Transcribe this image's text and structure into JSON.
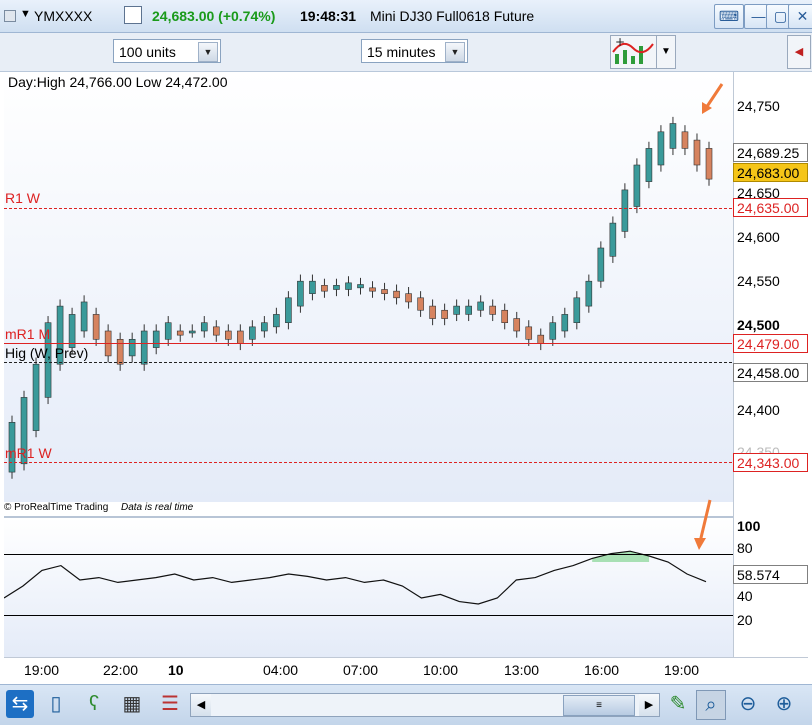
{
  "titlebar": {
    "symbol": "YMXXXX",
    "price_change": "24,683.00 (+0.74%)",
    "time": "19:48:31",
    "instrument": "Mini DJ30 Full0618 Future",
    "dropdown_icon": "caret-down-icon",
    "tile_icon": "tile-window-icon",
    "keyboard_icon": "keyboard-icon",
    "minimize_icon": "minimize-icon",
    "restore_icon": "restore-icon",
    "close_icon": "close-icon"
  },
  "toolbar": {
    "units_value": "100 units",
    "interval_value": "15 minutes"
  },
  "chart": {
    "day_info": "Day:High 24,766.00 Low 24,472.00",
    "credit": "© ProRealTime Trading",
    "realtime": "Data is real time",
    "level_labels": {
      "r1w": "R1 W",
      "mr1m": "mR1 M",
      "hig": "Hig (W, Prev)",
      "mr1w": "mR1 W"
    }
  },
  "price_axis": {
    "ticks": [
      "24,750",
      "24,650",
      "24,600",
      "24,550",
      "24,500",
      "24,458.00",
      "24,400",
      "24,350"
    ],
    "tags": {
      "current_high": "24,689.25",
      "last": "24,683.00",
      "r1w": "24,635.00",
      "mr1m": "24,479.00",
      "hig": "24,458.00",
      "mr1w": "24,343.00"
    }
  },
  "indicator_axis": {
    "ticks": [
      "100",
      "80",
      "40",
      "20"
    ],
    "value": "58.574"
  },
  "time_axis": {
    "labels": [
      "19:00",
      "22:00",
      "10",
      "04:00",
      "07:00",
      "10:00",
      "13:00",
      "16:00",
      "19:00"
    ]
  },
  "chart_data": {
    "type": "candlestick",
    "ylim": [
      24300,
      24800
    ],
    "candles": [
      [
        24330,
        24390
      ],
      [
        24340,
        24420
      ],
      [
        24380,
        24460
      ],
      [
        24420,
        24510
      ],
      [
        24460,
        24530
      ],
      [
        24480,
        24520
      ],
      [
        24500,
        24535
      ],
      [
        24490,
        24520
      ],
      [
        24470,
        24500
      ],
      [
        24460,
        24490
      ],
      [
        24470,
        24490
      ],
      [
        24460,
        24500
      ],
      [
        24480,
        24500
      ],
      [
        24490,
        24510
      ],
      [
        24495,
        24500
      ],
      [
        24500,
        24500
      ],
      [
        24500,
        24510
      ],
      [
        24495,
        24505
      ],
      [
        24490,
        24500
      ],
      [
        24485,
        24500
      ],
      [
        24490,
        24505
      ],
      [
        24500,
        24510
      ],
      [
        24505,
        24520
      ],
      [
        24510,
        24540
      ],
      [
        24530,
        24560
      ],
      [
        24545,
        24560
      ],
      [
        24548,
        24555
      ],
      [
        24550,
        24555
      ],
      [
        24550,
        24558
      ],
      [
        24552,
        24556
      ],
      [
        24548,
        24552
      ],
      [
        24545,
        24550
      ],
      [
        24540,
        24548
      ],
      [
        24535,
        24545
      ],
      [
        24525,
        24540
      ],
      [
        24515,
        24530
      ],
      [
        24515,
        24525
      ],
      [
        24520,
        24530
      ],
      [
        24520,
        24530
      ],
      [
        24525,
        24535
      ],
      [
        24520,
        24530
      ],
      [
        24510,
        24525
      ],
      [
        24500,
        24515
      ],
      [
        24490,
        24505
      ],
      [
        24485,
        24495
      ],
      [
        24490,
        24510
      ],
      [
        24500,
        24520
      ],
      [
        24510,
        24540
      ],
      [
        24530,
        24560
      ],
      [
        24560,
        24600
      ],
      [
        24590,
        24630
      ],
      [
        24620,
        24670
      ],
      [
        24650,
        24700
      ],
      [
        24680,
        24720
      ],
      [
        24700,
        24740
      ],
      [
        24720,
        24750
      ],
      [
        24720,
        24740
      ],
      [
        24700,
        24730
      ],
      [
        24683,
        24720
      ]
    ],
    "levels": {
      "r1w": 24635,
      "mr1m": 24479,
      "hig": 24458,
      "mr1w": 24343
    },
    "indicator": {
      "ylim": [
        0,
        110
      ],
      "upper_band": 75,
      "lower_band": 23,
      "values": [
        45,
        55,
        68,
        72,
        60,
        62,
        58,
        60,
        62,
        65,
        60,
        62,
        58,
        60,
        62,
        65,
        63,
        60,
        62,
        58,
        60,
        55,
        45,
        48,
        42,
        40,
        45,
        60,
        62,
        68,
        72,
        78,
        82,
        84,
        80,
        75,
        65,
        58.574
      ]
    }
  },
  "bottombar": {
    "icons": [
      "share-icon",
      "phone-icon",
      "drawing-tools-icon",
      "chart-grid-icon",
      "indicator-list-icon",
      "scroll-left-icon",
      "scroll-right-icon",
      "drawing-icon",
      "zoom-select-icon",
      "zoom-out-icon",
      "zoom-in-icon"
    ]
  }
}
